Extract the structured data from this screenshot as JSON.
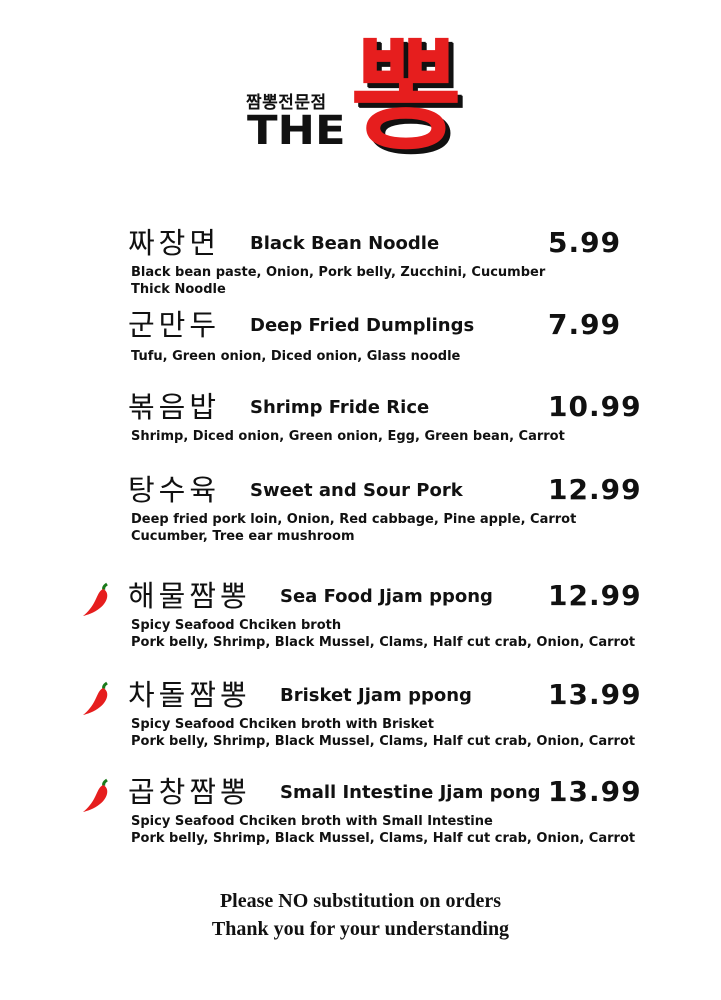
{
  "logo": {
    "subtitle": "짬뽕전문점",
    "the": "THE",
    "big": "뽕"
  },
  "menu": [
    {
      "korean": "짜장면",
      "english": "Black Bean Noodle",
      "price": "5.99",
      "desc": [
        "Black bean paste, Onion, Pork belly, Zucchini, Cucumber",
        "Thick Noodle"
      ],
      "spicy": false
    },
    {
      "korean": "군만두",
      "english": "Deep Fried Dumplings",
      "price": "7.99",
      "desc": [
        "Tufu, Green onion, Diced onion, Glass noodle"
      ],
      "spicy": false
    },
    {
      "korean": "볶음밥",
      "english": "Shrimp Fride Rice",
      "price": "10.99",
      "desc": [
        "Shrimp, Diced onion, Green onion, Egg, Green bean, Carrot"
      ],
      "spicy": false
    },
    {
      "korean": "탕수육",
      "english": "Sweet and Sour Pork",
      "price": "12.99",
      "desc": [
        "Deep fried pork loin, Onion, Red cabbage, Pine apple, Carrot",
        "Cucumber, Tree ear mushroom"
      ],
      "spicy": false
    },
    {
      "korean": "해물짬뽕",
      "english": "Sea Food Jjam ppong",
      "price": "12.99",
      "desc": [
        "Spicy Seafood Chciken broth",
        "Pork belly, Shrimp, Black Mussel, Clams, Half cut crab, Onion, Carrot"
      ],
      "spicy": true
    },
    {
      "korean": "차돌짬뽕",
      "english": "Brisket Jjam ppong",
      "price": "13.99",
      "desc": [
        "Spicy Seafood Chciken broth with Brisket",
        "Pork belly, Shrimp, Black Mussel, Clams, Half cut crab, Onion, Carrot"
      ],
      "spicy": true
    },
    {
      "korean": "곱창짬뽕",
      "english": "Small Intestine Jjam pong",
      "price": "13.99",
      "desc": [
        "Spicy Seafood Chciken broth with Small Intestine",
        "Pork belly, Shrimp, Black Mussel, Clams, Half cut crab, Onion, Carrot"
      ],
      "spicy": true
    }
  ],
  "footer": {
    "line1": "Please NO substitution on orders",
    "line2": "Thank you for your understanding"
  },
  "colors": {
    "accent_red": "#e61e1e",
    "text": "#111111"
  },
  "icons": {
    "spicy": "chili-pepper-icon"
  }
}
